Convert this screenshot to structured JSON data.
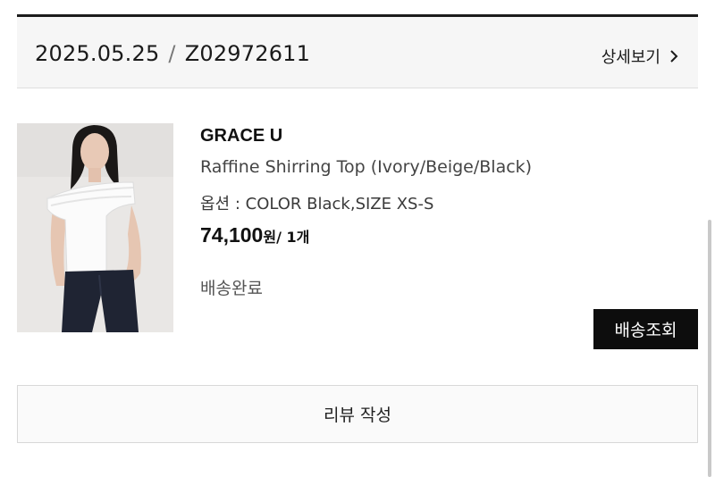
{
  "order": {
    "date": "2025.05.25",
    "separator": "/",
    "number": "Z02972611",
    "detail_link_label": "상세보기"
  },
  "product": {
    "brand": "GRACE U",
    "name": "Raffine Shirring Top (Ivory/Beige/Black)",
    "option": "옵션 : COLOR Black,SIZE XS-S",
    "price": "74,100",
    "price_unit": "원",
    "quantity": "/ 1개",
    "status": "배송완료",
    "image_icon": "product-photo"
  },
  "actions": {
    "track_label": "배송조회",
    "review_label": "리뷰 작성"
  },
  "colors": {
    "accent": "#0d0d0d",
    "header_bg": "#f6f6f6",
    "border": "#d8d8d8"
  }
}
